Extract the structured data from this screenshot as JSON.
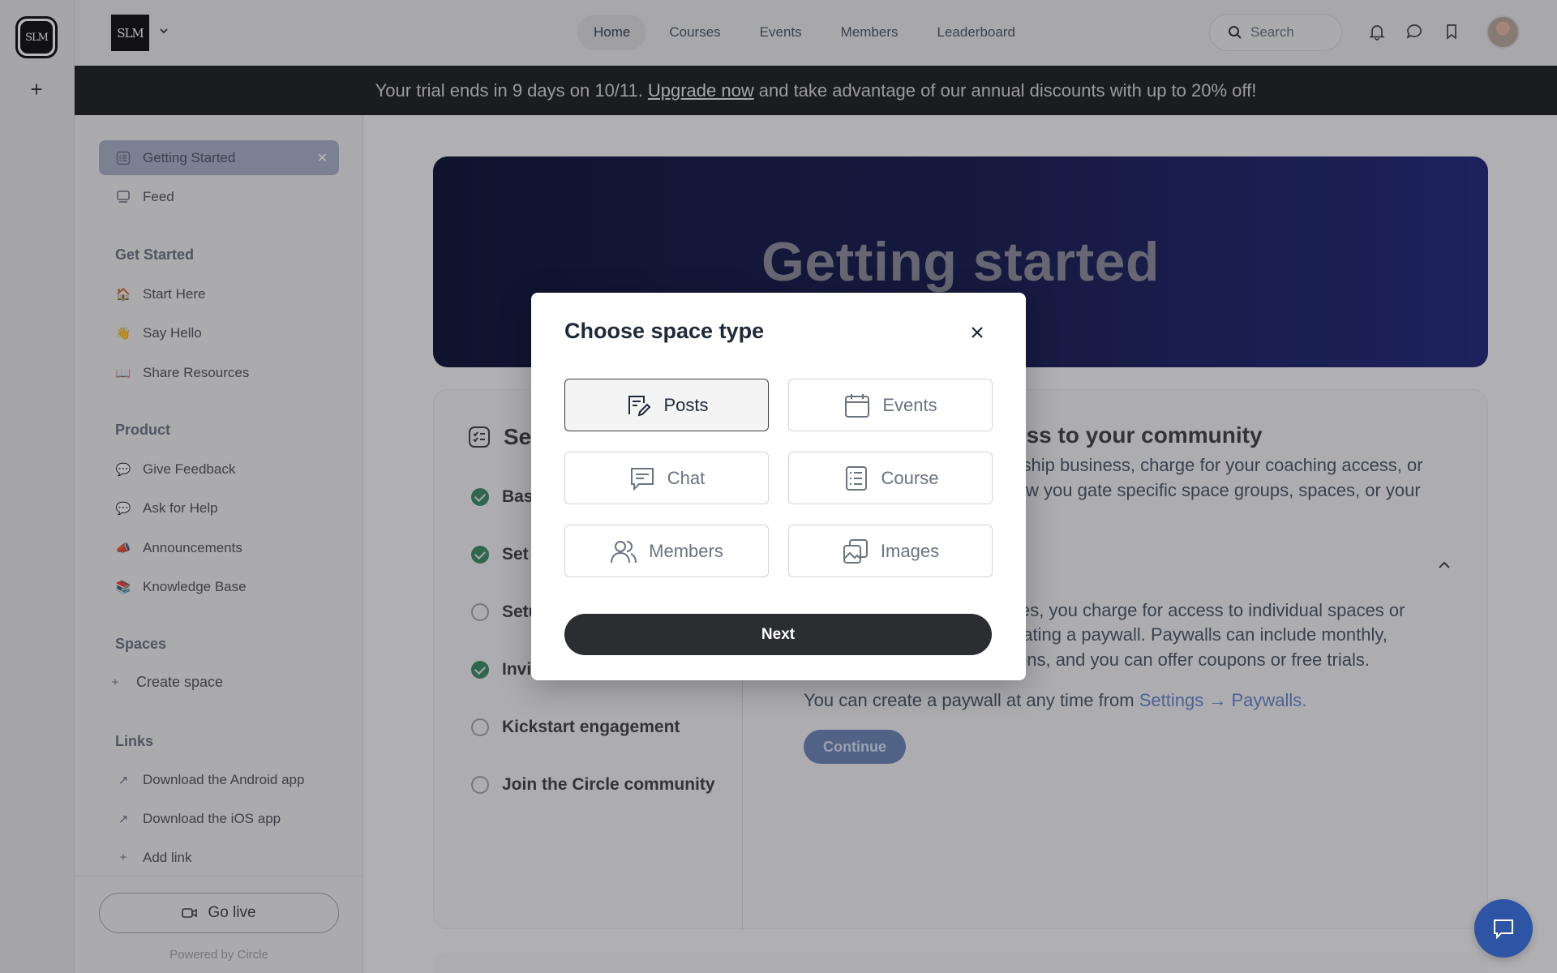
{
  "rail": {
    "logo_text": "SLM"
  },
  "header": {
    "brand_text": "SLM",
    "nav": [
      "Home",
      "Courses",
      "Events",
      "Members",
      "Leaderboard"
    ],
    "search_label": "Search"
  },
  "banner": {
    "text_before": "Your trial ends in 9 days on 10/11.",
    "link": "Upgrade now",
    "text_after": "and take advantage of our annual discounts with up to 20% off!"
  },
  "sidebar": {
    "top_items": [
      {
        "label": "Getting Started",
        "icon": "checklist-icon",
        "active": true
      },
      {
        "label": "Feed",
        "icon": "feed-icon"
      }
    ],
    "sections": [
      {
        "title": "Get Started",
        "items": [
          {
            "label": "Start Here",
            "icon": "🏠"
          },
          {
            "label": "Say Hello",
            "icon": "👋"
          },
          {
            "label": "Share Resources",
            "icon": "📖"
          }
        ]
      },
      {
        "title": "Product",
        "items": [
          {
            "label": "Give Feedback",
            "icon": "💬"
          },
          {
            "label": "Ask for Help",
            "icon": "💬"
          },
          {
            "label": "Announcements",
            "icon": "📣"
          },
          {
            "label": "Knowledge Base",
            "icon": "📚"
          }
        ]
      },
      {
        "title": "Spaces",
        "items": [
          {
            "label": "Create space",
            "icon": "+"
          }
        ]
      },
      {
        "title": "Links",
        "items": [
          {
            "label": "Download the Android app",
            "icon": "↗"
          },
          {
            "label": "Download the iOS app",
            "icon": "↗"
          },
          {
            "label": "Add link",
            "icon": "+"
          }
        ]
      }
    ],
    "go_live": "Go live",
    "powered_by": "Powered by Circle"
  },
  "hero": {
    "title": "Getting started"
  },
  "setup": {
    "title": "Set",
    "steps": [
      {
        "label": "Bas",
        "done": true
      },
      {
        "label": "Set",
        "done": true
      },
      {
        "label": "Setu",
        "done": false
      },
      {
        "label": "Invit",
        "done": true
      },
      {
        "label": "Kickstart engagement",
        "done": false
      },
      {
        "label": "Join the Circle community",
        "done": false
      }
    ]
  },
  "panel": {
    "title": "ess to your community",
    "line1": "ership business, charge for your coaching access, or",
    "line2": "llow you gate specific space groups, spaces, or your",
    "line3": "ces, you charge for access to individual spaces or",
    "line4": "eating a paywall. Paywalls can include monthly,",
    "line5": "tions, and you can offer coupons or free trials.",
    "line6_before": "You can create a paywall at any time from",
    "line6_link": "Settings → Paywalls.",
    "continue": "Continue"
  },
  "modal": {
    "title": "Choose space type",
    "options": [
      {
        "label": "Posts",
        "icon": "posts-icon",
        "selected": true
      },
      {
        "label": "Events",
        "icon": "calendar-icon",
        "selected": false
      },
      {
        "label": "Chat",
        "icon": "chat-icon",
        "selected": false
      },
      {
        "label": "Course",
        "icon": "course-icon",
        "selected": false
      },
      {
        "label": "Members",
        "icon": "members-icon",
        "selected": false
      },
      {
        "label": "Images",
        "icon": "images-icon",
        "selected": false
      }
    ],
    "next": "Next"
  },
  "colors": {
    "banner_bg": "#1f2023",
    "hero_gradient_start": "#0f1336",
    "hero_gradient_end": "#22287a",
    "active_sidebar": "#a9afc7",
    "step_done": "#3d8a64",
    "fab": "#2e54a6",
    "next_button": "#2c2d30"
  }
}
